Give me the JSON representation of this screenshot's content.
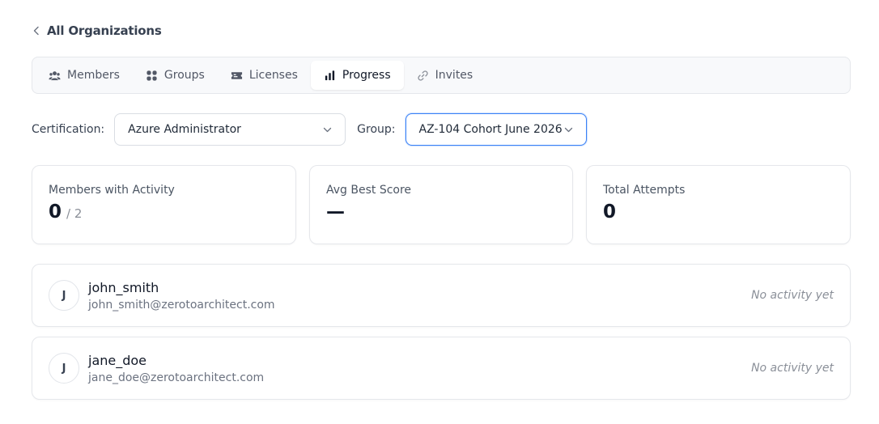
{
  "header": {
    "back_label": "All Organizations"
  },
  "tabs": [
    {
      "label": "Members",
      "icon": "users-icon",
      "active": false
    },
    {
      "label": "Groups",
      "icon": "grid-icon",
      "active": false
    },
    {
      "label": "Licenses",
      "icon": "ticket-icon",
      "active": false
    },
    {
      "label": "Progress",
      "icon": "bar-chart-icon",
      "active": true
    },
    {
      "label": "Invites",
      "icon": "link-icon",
      "active": false
    }
  ],
  "filters": {
    "certification_label": "Certification:",
    "certification_value": "Azure Administrator",
    "group_label": "Group:",
    "group_value": "AZ-104 Cohort June 2026"
  },
  "stats": [
    {
      "label": "Members with Activity",
      "value": "0",
      "sub": "/ 2"
    },
    {
      "label": "Avg Best Score",
      "value": "—",
      "sub": ""
    },
    {
      "label": "Total Attempts",
      "value": "0",
      "sub": ""
    }
  ],
  "members": [
    {
      "initial": "J",
      "name": "john_smith",
      "email": "john_smith@zerotoarchitect.com",
      "status": "No activity yet"
    },
    {
      "initial": "J",
      "name": "jane_doe",
      "email": "jane_doe@zerotoarchitect.com",
      "status": "No activity yet"
    }
  ],
  "colors": {
    "accent_border": "#3b82f6",
    "card_border": "#e5e7eb",
    "muted_text": "#8a8f98"
  }
}
